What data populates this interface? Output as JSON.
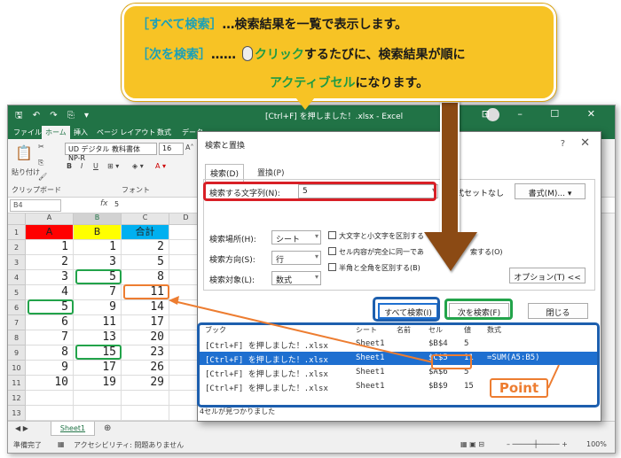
{
  "callout": {
    "line1_bracket": "［すべて検索］",
    "line1_rest": "…検索結果を一覧で表示します。",
    "line2_bracket": "［次を検索］",
    "line2_mid": "……",
    "line2_click": "クリック",
    "line2_rest": "するたびに、検索結果が順に",
    "line3_green": "アクティブセル",
    "line3_rest": "になります。"
  },
  "excel": {
    "title": "[Ctrl+F] を押しました！.xlsx - Excel",
    "tabs": [
      "ファイル",
      "ホーム",
      "挿入",
      "ページ レイアウト",
      "数式",
      "データ"
    ],
    "active_tab": "ホーム",
    "ribbon": {
      "paste": "貼り付け",
      "clipboard": "クリップボード",
      "font_group": "フォント",
      "font_name": "UD デジタル 教科書体 NP-R",
      "font_size": "16",
      "bold": "B",
      "italic": "I",
      "underline": "U"
    },
    "name_box": "B4",
    "fx": "fx",
    "formula_value": "5",
    "columns": [
      "A",
      "B",
      "C",
      "D"
    ],
    "header_row": [
      "A",
      "B",
      "合計"
    ],
    "rows": [
      [
        "1",
        "1",
        "2"
      ],
      [
        "2",
        "3",
        "5"
      ],
      [
        "3",
        "5",
        "8"
      ],
      [
        "4",
        "7",
        "11"
      ],
      [
        "5",
        "9",
        "14"
      ],
      [
        "6",
        "11",
        "17"
      ],
      [
        "7",
        "13",
        "20"
      ],
      [
        "8",
        "15",
        "23"
      ],
      [
        "9",
        "17",
        "26"
      ],
      [
        "10",
        "19",
        "29"
      ]
    ],
    "row_numbers": [
      "1",
      "2",
      "3",
      "4",
      "5",
      "6",
      "7",
      "8",
      "9",
      "10",
      "11",
      "12",
      "13"
    ],
    "sheet_tab": "Sheet1",
    "status_ready": "準備完了",
    "status_accessibility": "アクセシビリティ: 問題ありません",
    "zoom": "100%"
  },
  "dialog": {
    "title": "検索と置換",
    "help": "?",
    "close": "✕",
    "tab_find": "検索(D)",
    "tab_replace": "置換(P)",
    "find_label": "検索する文字列(N):",
    "find_value": "5",
    "format_none": "式セットなし",
    "format_button": "書式(M)...",
    "scope_label": "検索場所(H):",
    "scope_value": "シート",
    "direction_label": "検索方向(S):",
    "direction_value": "行",
    "target_label": "検索対象(L):",
    "target_value": "数式",
    "chk_case": "大文字と小文字を区別する",
    "chk_whole": "セル内容が完全に同一であ",
    "chk_width": "半角と全角を区別する(B)",
    "partial_text": "索する(O)",
    "options_button": "オプション(T) <<",
    "find_all": "すべて検索(I)",
    "find_next": "次を検索(F)",
    "close_button": "閉じる",
    "results_headers": [
      "ブック",
      "シート",
      "名前",
      "セル",
      "値",
      "数式"
    ],
    "results": [
      {
        "book": "[Ctrl+F] を押しました！.xlsx",
        "sheet": "Sheet1",
        "name": "",
        "cell": "$B$4",
        "value": "5",
        "formula": ""
      },
      {
        "book": "[Ctrl+F] を押しました！.xlsx",
        "sheet": "Sheet1",
        "name": "",
        "cell": "$C$5",
        "value": "11",
        "formula": "=SUM(A5:B5)"
      },
      {
        "book": "[Ctrl+F] を押しました！.xlsx",
        "sheet": "Sheet1",
        "name": "",
        "cell": "$A$6",
        "value": "5",
        "formula": ""
      },
      {
        "book": "[Ctrl+F] を押しました！.xlsx",
        "sheet": "Sheet1",
        "name": "",
        "cell": "$B$9",
        "value": "15",
        "formula": ""
      }
    ],
    "status": "4セルが見つかりました"
  },
  "point_label": "Point",
  "colors": {
    "excel_green": "#217346",
    "callout_yellow": "#f7c325",
    "teal": "#1aa0b8",
    "green": "#22a34a",
    "orange": "#ed7d31",
    "red": "#d81f26",
    "blue": "#1d5fae",
    "selection_blue": "#1e6fd0",
    "header_red": "#ff0000",
    "header_yellow": "#ffff00",
    "header_cyan": "#00b0f0"
  }
}
